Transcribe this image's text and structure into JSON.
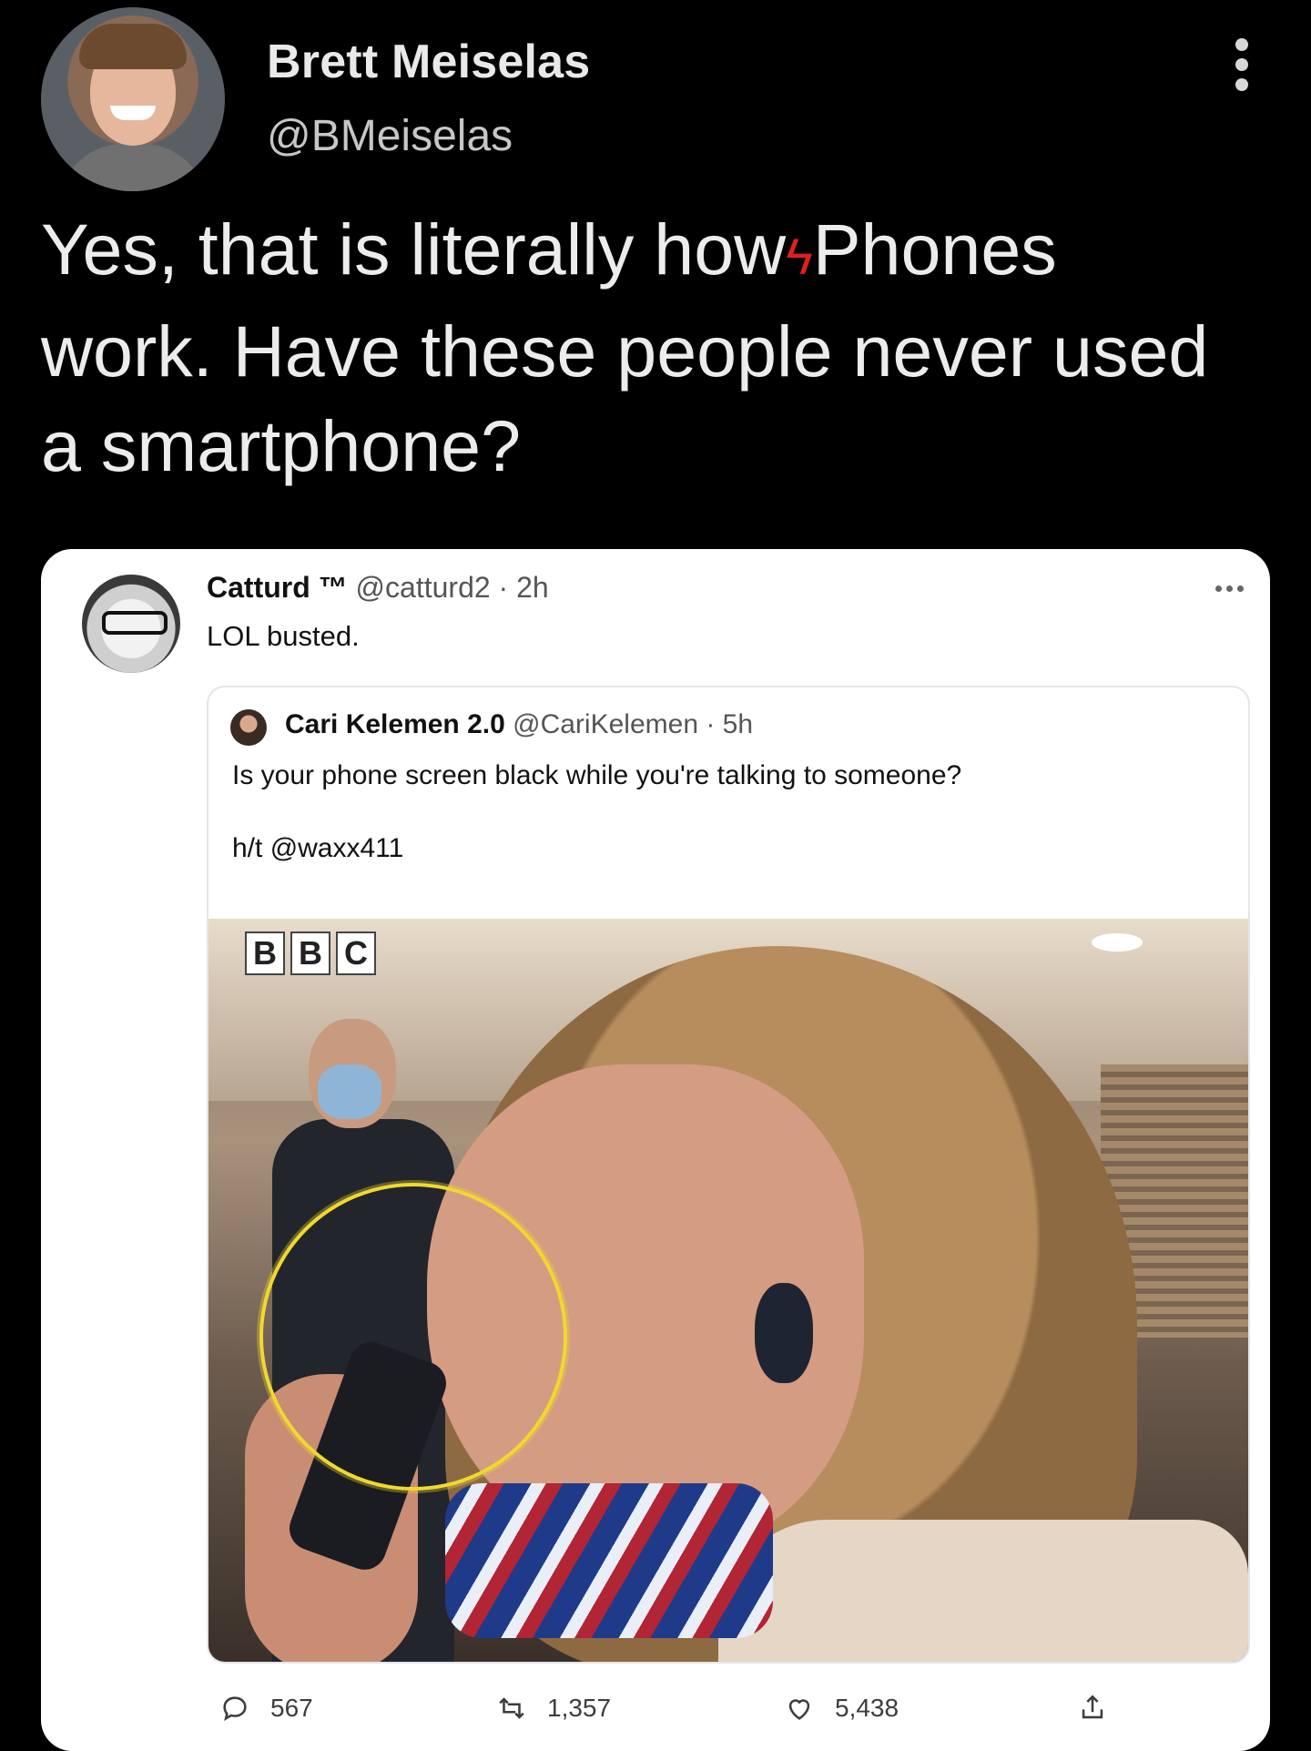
{
  "tweet": {
    "author_name": "Brett Meiselas",
    "author_handle": "@BMeiselas",
    "text_before": "Yes, that is literally how",
    "text_after": "Phones\nwork. Have these people never used\na smartphone?"
  },
  "quoted_tweet": {
    "author_name": "Catturd ™",
    "author_handle": "@catturd2",
    "time": "· 2h",
    "text": "LOL busted.",
    "nested": {
      "author_name": "Cari Kelemen 2.0",
      "author_handle": "@CariKelemen",
      "time": "· 5h",
      "text_line1": "Is your phone screen black while you're talking to someone?",
      "text_line2": "h/t @waxx411",
      "image_watermark": [
        "B",
        "B",
        "C"
      ]
    },
    "stats": {
      "replies": "567",
      "retweets": "1,357",
      "likes": "5,438"
    }
  },
  "icons": {
    "more": "more-vertical-icon",
    "reply": "reply-icon",
    "retweet": "retweet-icon",
    "like": "heart-icon",
    "share": "share-icon"
  },
  "colors": {
    "background": "#000000",
    "card": "#ffffff",
    "highlight_circle": "#f0d830"
  }
}
